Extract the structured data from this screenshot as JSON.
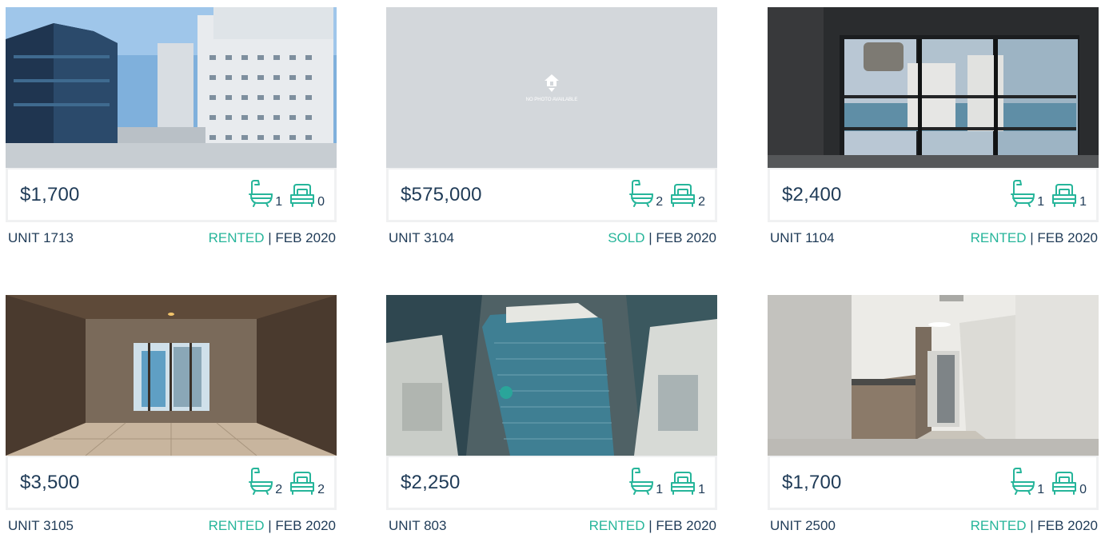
{
  "colors": {
    "accent": "#26b59a",
    "text": "#1f3b57",
    "box_border": "#f0f1f2"
  },
  "listings": [
    {
      "image": "downtown-skyline-towers",
      "price": "$1,700",
      "baths": "1",
      "beds": "0",
      "unit": "UNIT 1713",
      "status": "RENTED",
      "separator": "|",
      "date": "FEB 2020"
    },
    {
      "image": "no-photo-placeholder",
      "placeholder_text": "NO PHOTO AVAILABLE",
      "price": "$575,000",
      "baths": "2",
      "beds": "2",
      "unit": "UNIT 3104",
      "status": "SOLD",
      "separator": "|",
      "date": "FEB 2020"
    },
    {
      "image": "living-room-bay-view",
      "price": "$2,400",
      "baths": "1",
      "beds": "1",
      "unit": "UNIT 1104",
      "status": "RENTED",
      "separator": "|",
      "date": "FEB 2020"
    },
    {
      "image": "hallway-to-window",
      "price": "$3,500",
      "baths": "2",
      "beds": "2",
      "unit": "UNIT 3105",
      "status": "RENTED",
      "separator": "|",
      "date": "FEB 2020"
    },
    {
      "image": "aerial-tower-view",
      "price": "$2,250",
      "baths": "1",
      "beds": "1",
      "unit": "UNIT 803",
      "status": "RENTED",
      "separator": "|",
      "date": "FEB 2020"
    },
    {
      "image": "kitchen-hallway",
      "price": "$1,700",
      "baths": "1",
      "beds": "0",
      "unit": "UNIT 2500",
      "status": "RENTED",
      "separator": "|",
      "date": "FEB 2020"
    }
  ]
}
